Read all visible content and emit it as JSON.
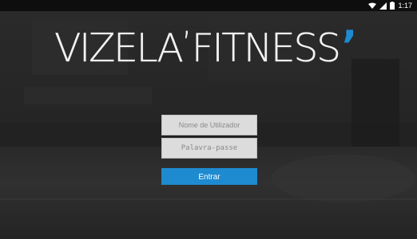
{
  "status_bar": {
    "time": "1:17",
    "icons": [
      "wifi-icon",
      "signal-icon",
      "battery-icon"
    ]
  },
  "logo": {
    "part1": "VIZELA",
    "apostrophe": "’",
    "part2": "FITNESS",
    "comma_mark": "’",
    "accent_color": "#1e8bd0"
  },
  "login": {
    "username_placeholder": "Nome de Utilizador",
    "password_placeholder": "Palavra-passe",
    "submit_label": "Entrar"
  },
  "colors": {
    "button": "#1e8bd0",
    "field_bg": "#dcdcdc"
  }
}
